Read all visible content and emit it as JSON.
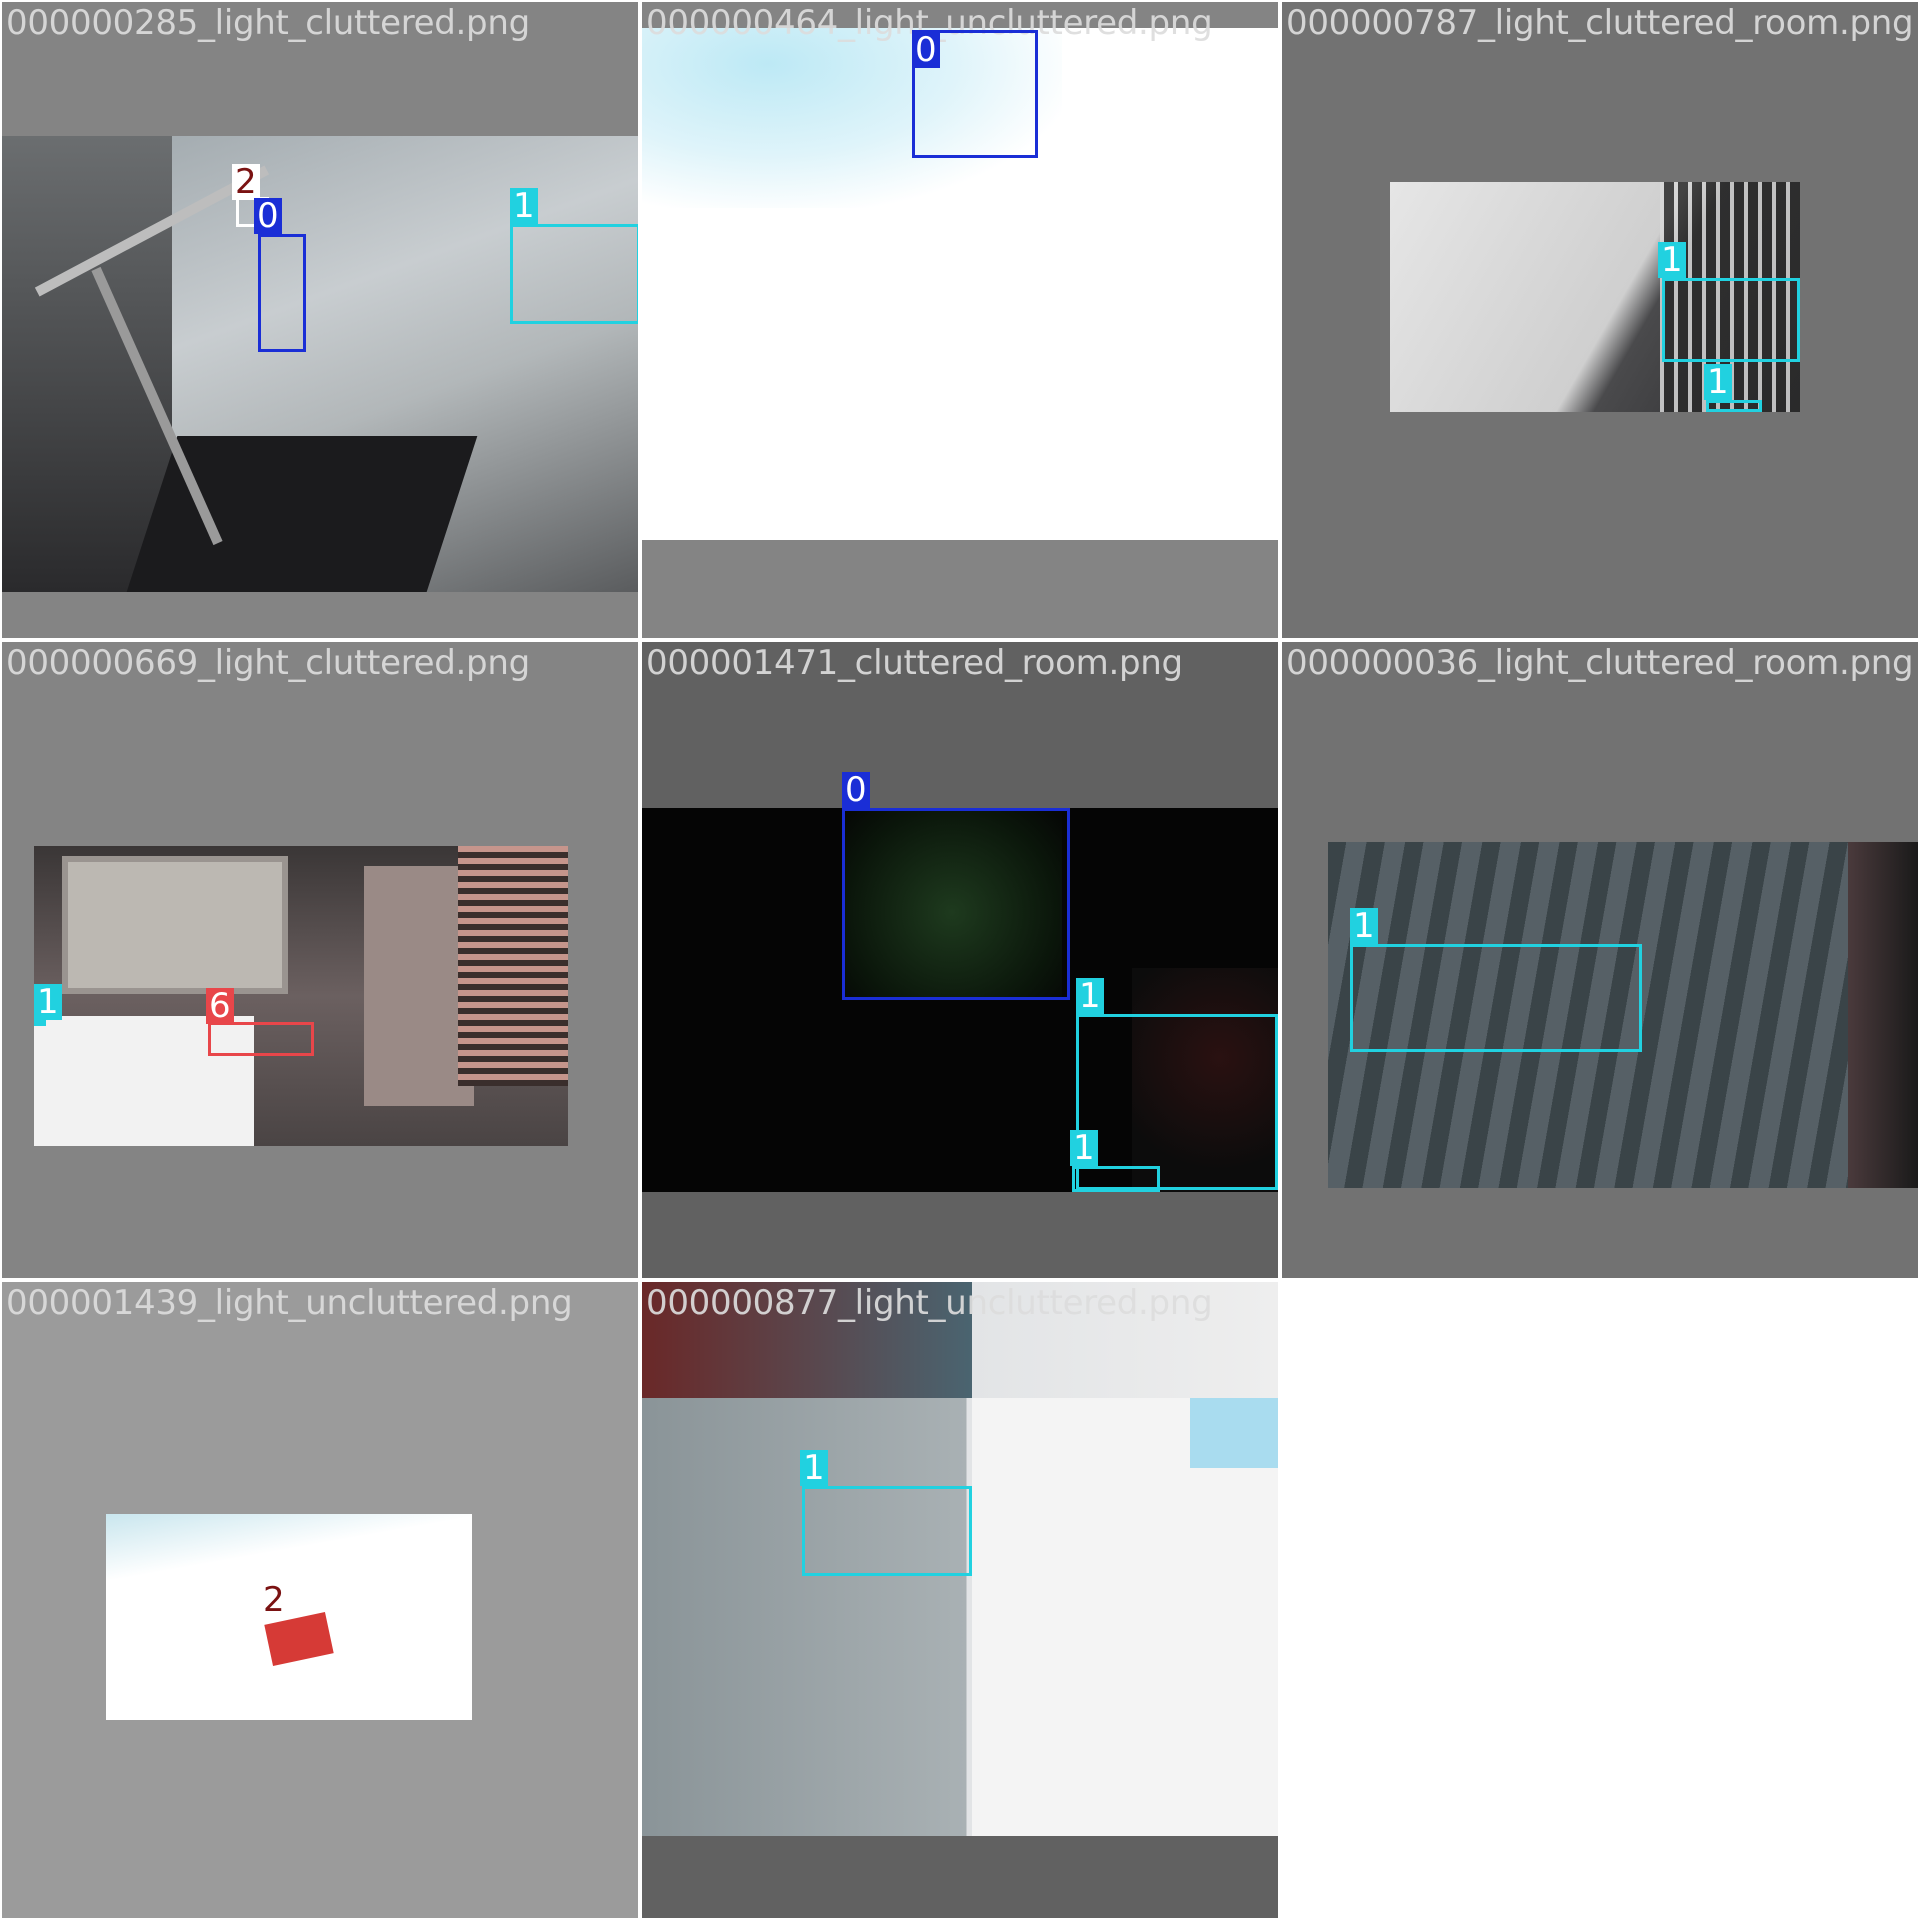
{
  "colors": {
    "class_0": "#1a2ed6",
    "class_1": "#21d1e0",
    "class_2": "#ffffff",
    "class_2_text": "#7a1212",
    "class_6": "#e8464a"
  },
  "tiles": [
    {
      "filename": "000000285_light_cluttered.png",
      "detections": [
        {
          "class": "2"
        },
        {
          "class": "0"
        },
        {
          "class": "1"
        }
      ]
    },
    {
      "filename": "000000464_light_uncluttered.png",
      "detections": [
        {
          "class": "0"
        }
      ]
    },
    {
      "filename": "000000787_light_cluttered_room.png",
      "detections": [
        {
          "class": "1"
        },
        {
          "class": "1"
        }
      ]
    },
    {
      "filename": "000000669_light_cluttered.png",
      "detections": [
        {
          "class": "1"
        },
        {
          "class": "6"
        }
      ]
    },
    {
      "filename": "000001471_cluttered_room.png",
      "detections": [
        {
          "class": "0"
        },
        {
          "class": "1"
        },
        {
          "class": "1"
        }
      ]
    },
    {
      "filename": "000000036_light_cluttered_room.png",
      "detections": [
        {
          "class": "1"
        }
      ]
    },
    {
      "filename": "000001439_light_uncluttered.png",
      "detections": [
        {
          "class": "2"
        }
      ]
    },
    {
      "filename": "000000877_light_uncluttered.png",
      "detections": [
        {
          "class": "1"
        }
      ]
    }
  ]
}
